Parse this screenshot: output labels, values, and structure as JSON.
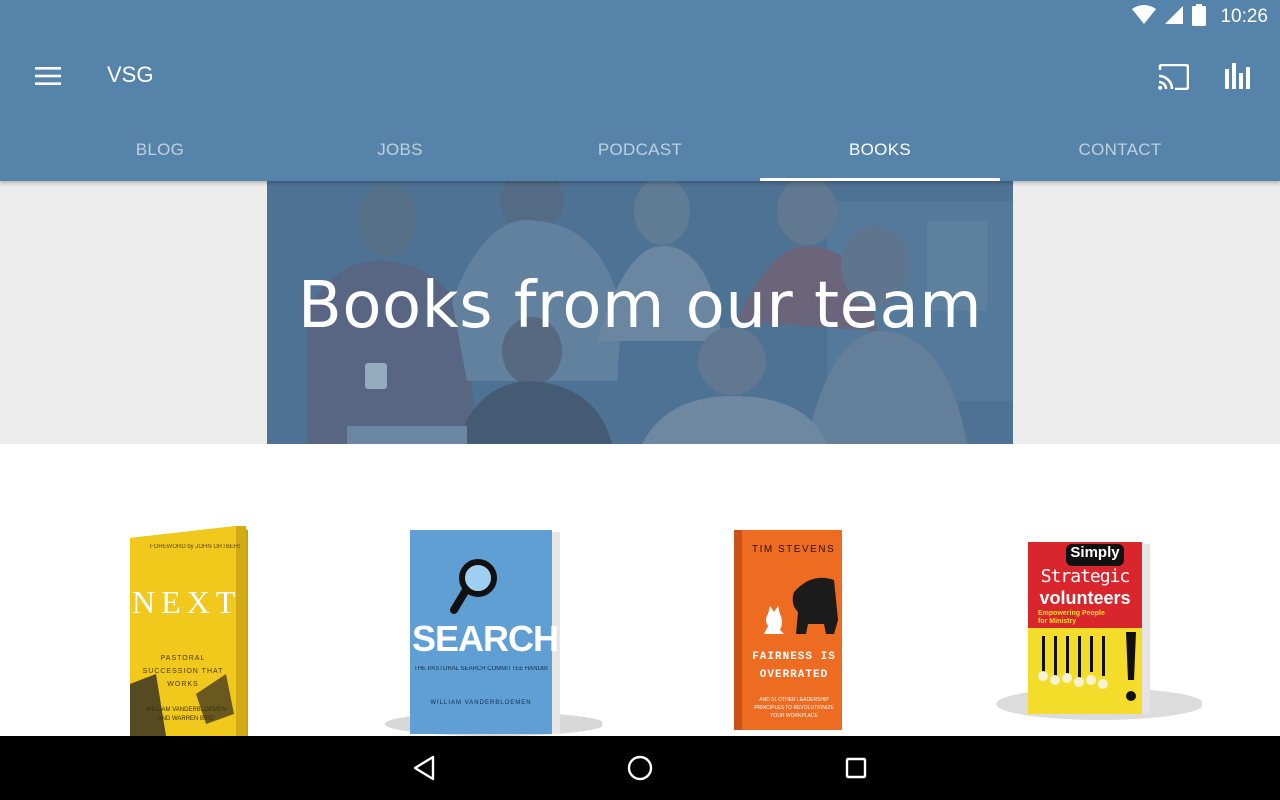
{
  "status_bar": {
    "time": "10:26"
  },
  "toolbar": {
    "title": "VSG",
    "menu_icon": "hamburger-menu-icon",
    "cast_icon": "cast-icon",
    "stats_icon": "bar-chart-icon"
  },
  "tabs": [
    {
      "label": "BLOG",
      "active": false
    },
    {
      "label": "JOBS",
      "active": false
    },
    {
      "label": "PODCAST",
      "active": false
    },
    {
      "label": "BOOKS",
      "active": true
    },
    {
      "label": "CONTACT",
      "active": false
    }
  ],
  "hero": {
    "title": "Books from our team"
  },
  "books": [
    {
      "title": "NEXT",
      "foreword": "FOREWORD by JOHN ORTBERG",
      "subtitle": "PASTORAL SUCCESSION THAT WORKS",
      "authors": "WILLIAM VANDERBLOEMEN AND WARREN BIRD",
      "color": "#f1c81c"
    },
    {
      "title": "SEARCH",
      "subtitle": "THE PASTORAL SEARCH COMMITTEE HANDBOOK",
      "authors": "WILLIAM VANDERBLOEMEN",
      "color": "#5f9fd3"
    },
    {
      "title": "FAIRNESS IS OVERRATED",
      "author": "TIM STEVENS",
      "subtitle": "AND 51 OTHER LEADERSHIP PRINCIPLES TO REVOLUTIONIZE YOUR WORKPLACE",
      "color": "#ee6b22"
    },
    {
      "title_top": "Simply",
      "title_mid": "Strategic",
      "title_bottom": "volunteers",
      "subtitle": "Empowering People for Ministry",
      "color": "#f4dd2a"
    }
  ],
  "colors": {
    "app_bar": "#5683a9",
    "hero_overlay": "#4a6e8e",
    "band": "#ececec"
  },
  "navigation": {
    "back_icon": "back-triangle-icon",
    "home_icon": "home-circle-icon",
    "recents_icon": "recents-square-icon"
  }
}
